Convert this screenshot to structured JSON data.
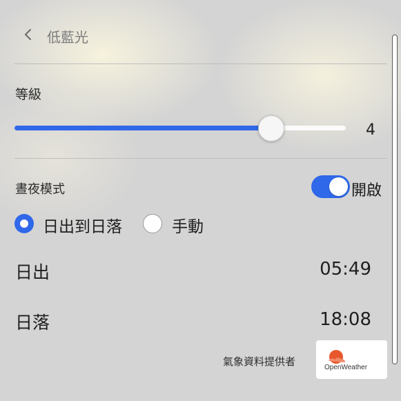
{
  "header": {
    "title": "低藍光"
  },
  "level": {
    "label": "等級",
    "value": 4,
    "fraction": 0.775,
    "value_text": "4"
  },
  "day_night": {
    "label": "晝夜模式",
    "toggle_state": "開啟",
    "enabled": true,
    "options": [
      {
        "label": "日出到日落",
        "selected": true
      },
      {
        "label": "手動",
        "selected": false
      }
    ]
  },
  "sunrise": {
    "label": "日出",
    "time": "05:49"
  },
  "sunset": {
    "label": "日落",
    "time": "18:08"
  },
  "provider": {
    "label": "氣象資料提供者",
    "logo_text": "OpenWeather"
  },
  "colors": {
    "accent": "#2f68e8",
    "logo_orange": "#e8582c"
  }
}
